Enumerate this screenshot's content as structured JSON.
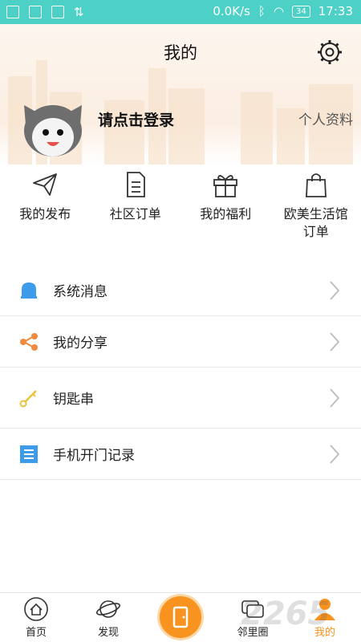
{
  "status_bar": {
    "speed": "0.0K/s",
    "battery": "34",
    "time": "17:33",
    "bg_color": "#4dd0c6"
  },
  "header": {
    "title": "我的",
    "login_prompt": "请点击登录",
    "profile_link": "个人资料"
  },
  "quick_actions": [
    {
      "label": "我的发布",
      "icon": "paper-plane-icon"
    },
    {
      "label": "社区订单",
      "icon": "document-icon"
    },
    {
      "label": "我的福利",
      "icon": "gift-icon"
    },
    {
      "label": "欧美生活馆\n订单",
      "icon": "shopping-bag-icon"
    }
  ],
  "menu": [
    {
      "label": "系统消息",
      "icon": "bell-icon",
      "color": "#3d9be9"
    },
    {
      "label": "我的分享",
      "icon": "share-icon",
      "color": "#f08a3c"
    },
    {
      "label": "钥匙串",
      "icon": "key-icon",
      "color": "#e9c43a"
    },
    {
      "label": "手机开门记录",
      "icon": "list-icon",
      "color": "#3d9be9"
    }
  ],
  "tabs": [
    {
      "label": "首页",
      "icon": "home-icon"
    },
    {
      "label": "发现",
      "icon": "planet-icon"
    },
    {
      "label": "",
      "icon": "door-icon"
    },
    {
      "label": "邻里圈",
      "icon": "chat-icon"
    },
    {
      "label": "我的",
      "icon": "user-icon"
    }
  ],
  "accent_color": "#f7931e",
  "watermark": "2265"
}
